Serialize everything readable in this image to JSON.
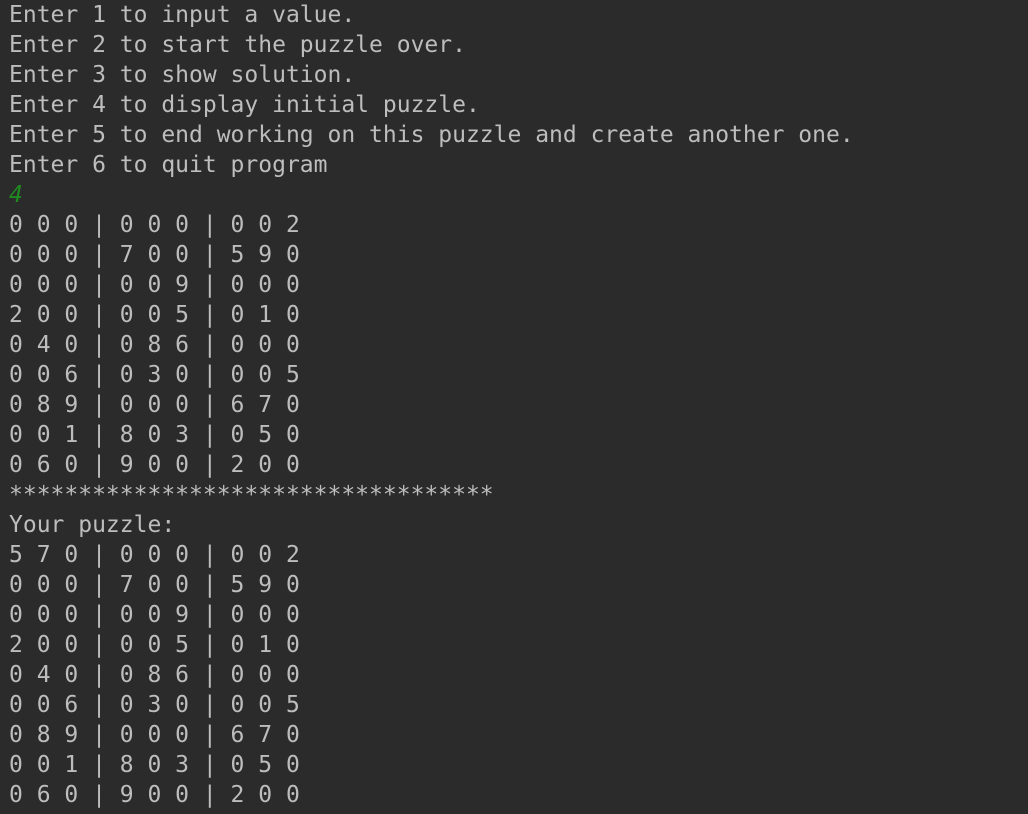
{
  "menu": {
    "lines": [
      "Enter 1 to input a value.",
      "Enter 2 to start the puzzle over.",
      "Enter 3 to show solution.",
      "Enter 4 to display initial puzzle.",
      "Enter 5 to end working on this puzzle and create another one.",
      "Enter 6 to quit program"
    ]
  },
  "user_input": "4",
  "initial_puzzle": {
    "rows": [
      "0 0 0 | 0 0 0 | 0 0 2",
      "0 0 0 | 7 0 0 | 5 9 0",
      "0 0 0 | 0 0 9 | 0 0 0",
      "2 0 0 | 0 0 5 | 0 1 0",
      "0 4 0 | 0 8 6 | 0 0 0",
      "0 0 6 | 0 3 0 | 0 0 5",
      "0 8 9 | 0 0 0 | 6 7 0",
      "0 0 1 | 8 0 3 | 0 5 0",
      "0 6 0 | 9 0 0 | 2 0 0"
    ]
  },
  "separator": "***********************************",
  "your_puzzle": {
    "label": "Your puzzle:",
    "rows": [
      "5 7 0 | 0 0 0 | 0 0 2",
      "0 0 0 | 7 0 0 | 5 9 0",
      "0 0 0 | 0 0 9 | 0 0 0",
      "2 0 0 | 0 0 5 | 0 1 0",
      "0 4 0 | 0 8 6 | 0 0 0",
      "0 0 6 | 0 3 0 | 0 0 5",
      "0 8 9 | 0 0 0 | 6 7 0",
      "0 0 1 | 8 0 3 | 0 5 0",
      "0 6 0 | 9 0 0 | 2 0 0"
    ]
  },
  "colors": {
    "background": "#2b2b2b",
    "text": "#bdbdbd",
    "input_echo": "#1f8a1f"
  }
}
